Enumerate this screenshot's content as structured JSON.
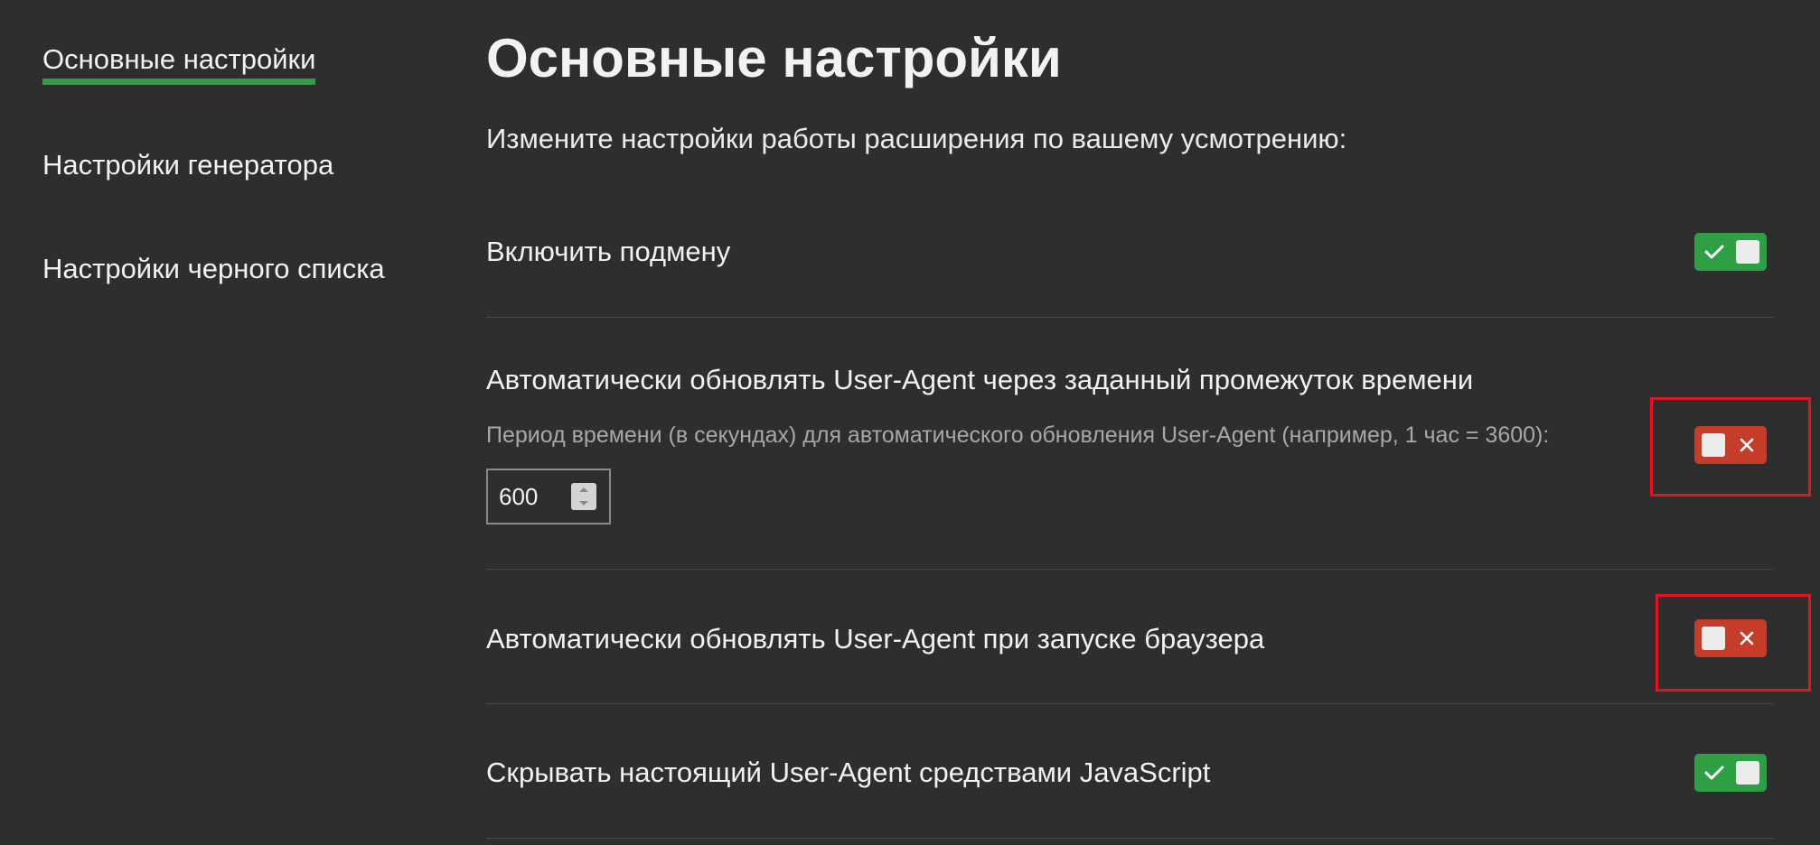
{
  "sidebar": {
    "items": [
      {
        "label": "Основные настройки",
        "active": true
      },
      {
        "label": "Настройки генератора",
        "active": false
      },
      {
        "label": "Настройки черного списка",
        "active": false
      }
    ]
  },
  "main": {
    "title": "Основные настройки",
    "subtitle": "Измените настройки работы расширения по вашему усмотрению:",
    "settings": [
      {
        "label": "Включить подмену",
        "enabled": true
      },
      {
        "label": "Автоматически обновлять User-Agent через заданный промежуток времени",
        "description": "Период времени (в секундах) для автоматического обновления User-Agent (например, 1 час = 3600):",
        "interval_value": "600",
        "enabled": false
      },
      {
        "label": "Автоматически обновлять User-Agent при запуске браузера",
        "enabled": false
      },
      {
        "label": "Скрывать настоящий User-Agent средствами JavaScript",
        "enabled": true
      }
    ]
  },
  "colors": {
    "background": "#2e2e2e",
    "accent_green": "#2ea043",
    "toggle_off_red": "#c43c2a",
    "highlight_red": "#e0151f"
  },
  "icons": {
    "toggle_on": "checkmark-icon",
    "toggle_off": "x-icon",
    "spinner_up": "triangle-up-icon",
    "spinner_down": "triangle-down-icon"
  }
}
